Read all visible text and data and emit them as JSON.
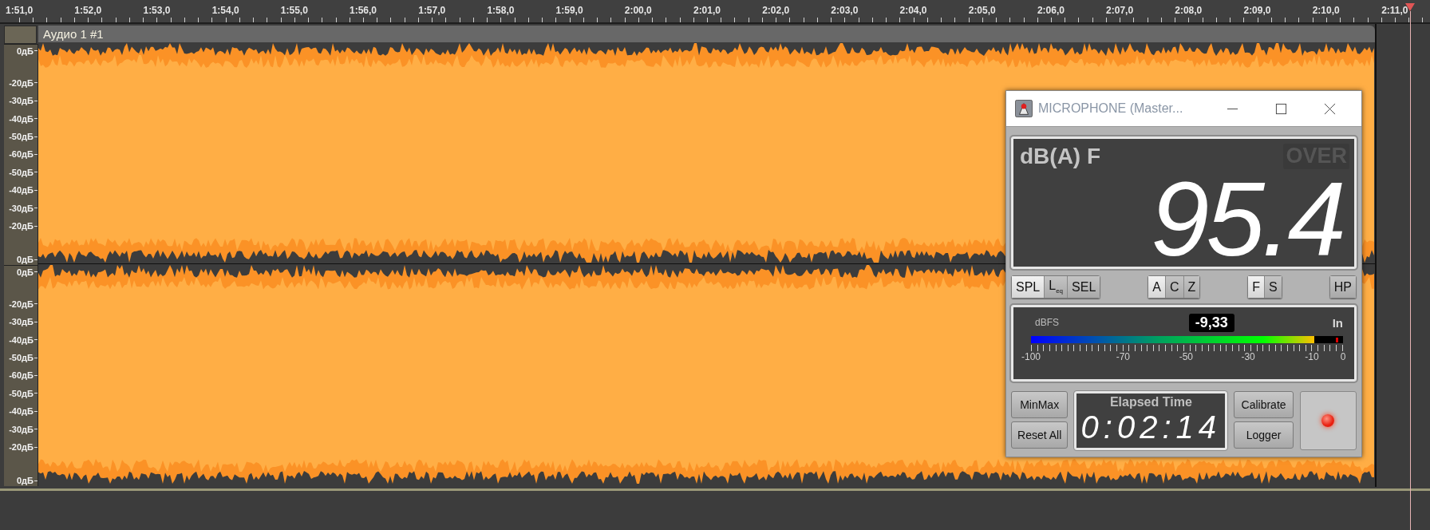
{
  "ruler": {
    "labels": [
      "1:51,0",
      "1:52,0",
      "1:53,0",
      "1:54,0",
      "1:55,0",
      "1:56,0",
      "1:57,0",
      "1:58,0",
      "1:59,0",
      "2:00,0",
      "2:01,0",
      "2:02,0",
      "2:03,0",
      "2:04,0",
      "2:05,0",
      "2:06,0",
      "2:07,0",
      "2:08,0",
      "2:09,0",
      "2:10,0",
      "2:11,0"
    ]
  },
  "track": {
    "title": "Аудио 1 #1",
    "channels": [
      {
        "scale": [
          "0дБ",
          "-20дБ",
          "-30дБ",
          "-40дБ",
          "-50дБ",
          "-60дБ",
          "-50дБ",
          "-40дБ",
          "-30дБ",
          "-20дБ",
          "0дБ"
        ]
      },
      {
        "scale": [
          "0дБ",
          "-20дБ",
          "-30дБ",
          "-40дБ",
          "-50дБ",
          "-60дБ",
          "-50дБ",
          "-40дБ",
          "-30дБ",
          "-20дБ",
          "0дБ"
        ]
      }
    ]
  },
  "meter_window": {
    "title": "MICROPHONE (Master...",
    "weighting_label": "dB(A) F",
    "over": {
      "label": "OVER",
      "on": false
    },
    "reading": "95.4",
    "mode_groups": [
      [
        {
          "label": "SPL",
          "selected": true
        },
        {
          "label": "L$_{eq}$",
          "selected": false
        },
        {
          "label": "SEL",
          "selected": false
        }
      ],
      [
        {
          "label": "A",
          "selected": true
        },
        {
          "label": "C",
          "selected": false
        },
        {
          "label": "Z",
          "selected": false
        }
      ],
      [
        {
          "label": "F",
          "selected": true
        },
        {
          "label": "S",
          "selected": false
        }
      ],
      [
        {
          "label": "HP",
          "selected": false
        }
      ]
    ],
    "level_meter": {
      "unit": "dBFS",
      "value": "-9,33",
      "source": "In",
      "level": 0.907,
      "scale": [
        "-100",
        "-70",
        "-50",
        "-30",
        "-10",
        "0"
      ]
    },
    "buttons_left": [
      "MinMax",
      "Reset All"
    ],
    "elapsed": {
      "label": "Elapsed Time",
      "value": "0:02:14"
    },
    "buttons_right": [
      "Calibrate",
      "Logger"
    ],
    "record": {
      "on": true
    }
  }
}
